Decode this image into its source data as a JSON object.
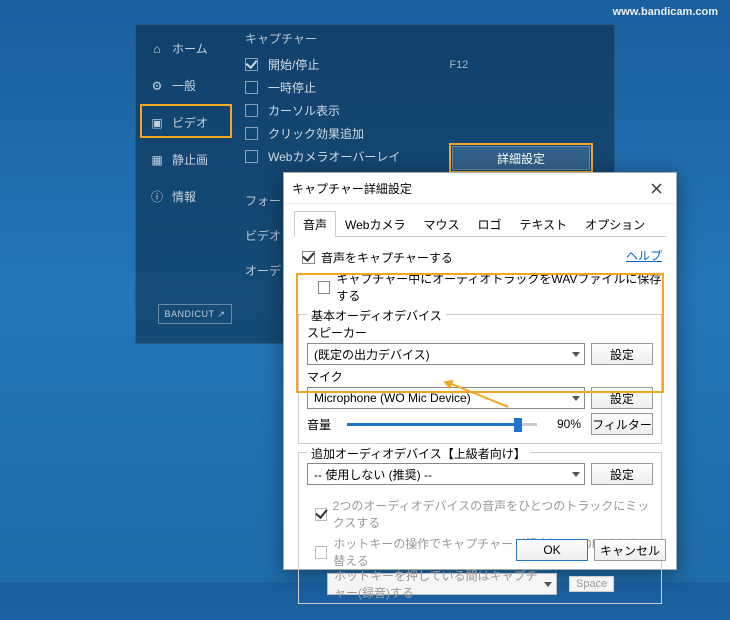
{
  "watermark": "www.bandicam.com",
  "sidebar": {
    "items": [
      {
        "label": "ホーム"
      },
      {
        "label": "一般"
      },
      {
        "label": "ビデオ"
      },
      {
        "label": "静止画"
      },
      {
        "label": "情報"
      }
    ]
  },
  "main": {
    "capture_heading": "キャプチャー",
    "start_stop": "開始/停止",
    "start_stop_hotkey": "F12",
    "pause": "一時停止",
    "show_cursor": "カーソル表示",
    "click_effect": "クリック効果追加",
    "webcam_overlay": "Webカメラオーバーレイ",
    "advanced_btn": "詳細設定",
    "format_heading": "フォー",
    "video_label": "ビデオ",
    "audio_label": "オーデ"
  },
  "bandicut": "BANDICUT ↗",
  "dialog": {
    "title": "キャプチャー詳細設定",
    "tabs": [
      "音声",
      "Webカメラ",
      "マウス",
      "ロゴ",
      "テキスト",
      "オプション"
    ],
    "help": "ヘルプ",
    "capture_audio": "音声をキャプチャーする",
    "save_wav": "キャプチャー中にオーディオトラックをWAVファイルに保存する",
    "primary_group": "基本オーディオデバイス",
    "speaker_label": "スピーカー",
    "speaker_value": "(既定の出力デバイス)",
    "mic_label": "マイク",
    "mic_value": "Microphone (WO Mic Device)",
    "volume_label": "音量",
    "volume_pct": "90%",
    "settings_btn": "設定",
    "filter_btn": "フィルター",
    "secondary_group": "追加オーディオデバイス【上級者向け】",
    "secondary_value": "-- 使用しない (推奨) --",
    "mix_label": "2つのオーディオデバイスの音声をひとつのトラックにミックスする",
    "hotkey_toggle_label": "ホットキーの操作でキャプチャー（録音）ON/OFFを切り替える",
    "hotkey_mode_value": "ホットキーを押している間はキャプチャー(録音)する",
    "hotkey_key": "Space",
    "ok": "OK",
    "cancel": "キャンセル"
  }
}
